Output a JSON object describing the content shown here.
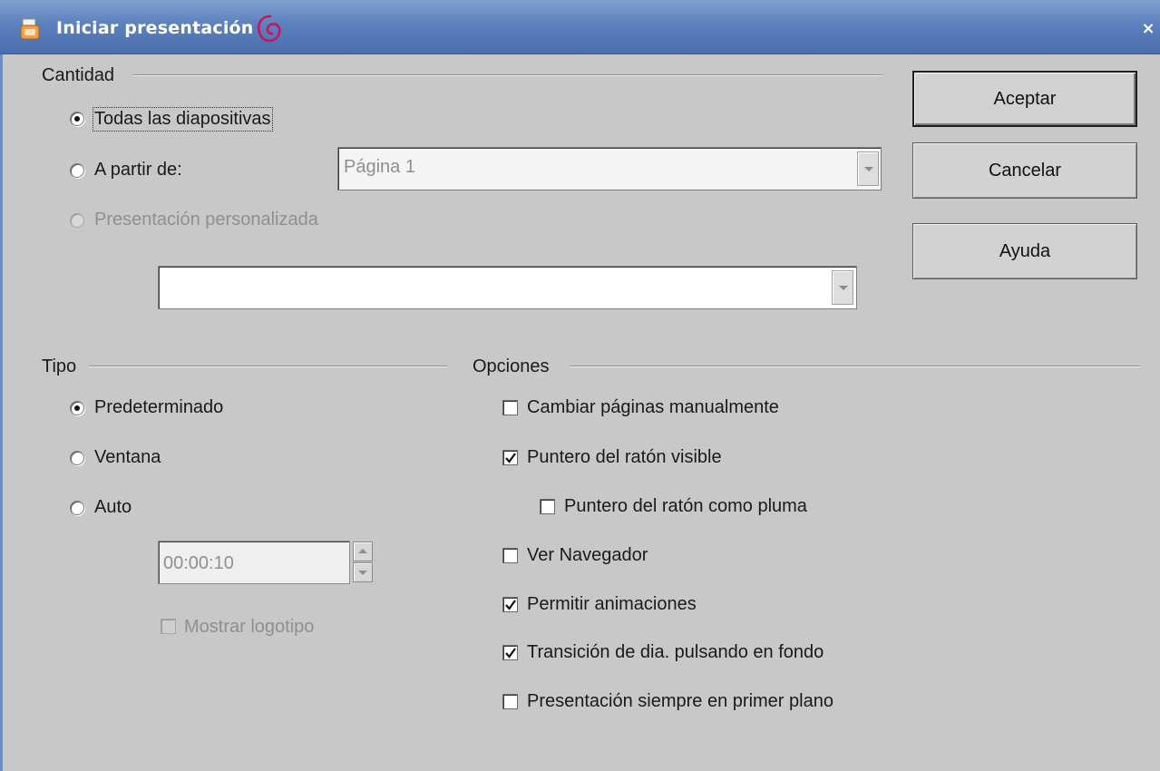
{
  "window": {
    "title": "Iniciar presentación",
    "close_glyph": "×",
    "title_bar_color": "#5d80be"
  },
  "cantidad": {
    "heading": "Cantidad",
    "options": [
      {
        "label": "Todas las diapositivas",
        "checked": true,
        "enabled": true
      },
      {
        "label": "A partir de:",
        "checked": false,
        "enabled": true
      },
      {
        "label": "Presentación personalizada",
        "checked": false,
        "enabled": false
      }
    ],
    "from_page_value": "Página 1",
    "custom_show_value": ""
  },
  "tipo": {
    "heading": "Tipo",
    "options": [
      {
        "label": "Predeterminado",
        "checked": true
      },
      {
        "label": "Ventana",
        "checked": false
      },
      {
        "label": "Auto",
        "checked": false
      }
    ],
    "pause_value": "00:00:10",
    "logo_label": "Mostrar logotipo",
    "logo_checked": false
  },
  "opciones": {
    "heading": "Opciones",
    "items": [
      {
        "label": "Cambiar páginas manualmente",
        "checked": false
      },
      {
        "label": "Puntero del ratón visible",
        "checked": true
      },
      {
        "label": "Puntero del ratón como pluma",
        "checked": false
      },
      {
        "label": "Ver Navegador",
        "checked": false
      },
      {
        "label": "Permitir animaciones",
        "checked": true
      },
      {
        "label": "Transición de dia. pulsando en fondo",
        "checked": true
      },
      {
        "label": "Presentación siempre en primer plano",
        "checked": false
      }
    ]
  },
  "buttons": {
    "ok": "Aceptar",
    "cancel": "Cancelar",
    "help": "Ayuda"
  },
  "icons": {
    "app": "impress-app-icon",
    "swirl": "debian-swirl-icon",
    "close": "close-icon",
    "dropdown": "chevron-down-icon",
    "spin_up": "spin-up-icon",
    "spin_down": "spin-down-icon",
    "check": "check-icon"
  }
}
